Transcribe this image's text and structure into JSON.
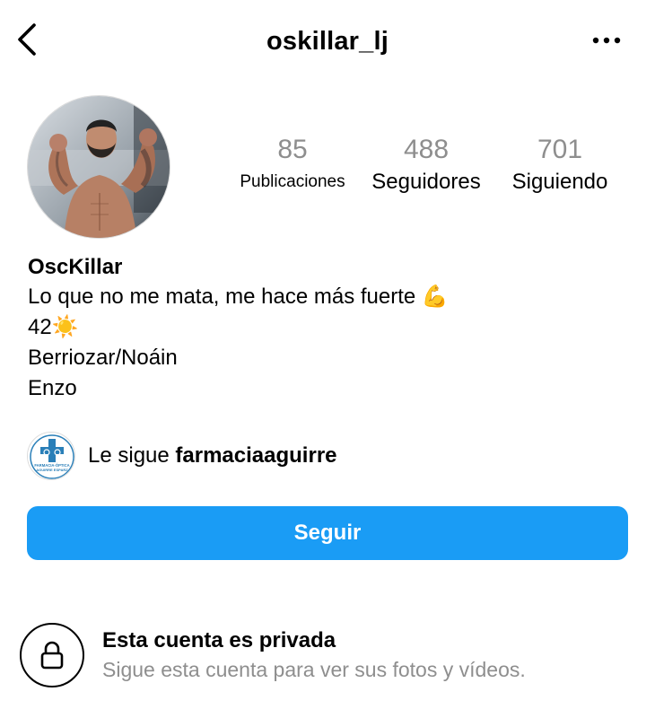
{
  "header": {
    "username": "oskillar_lj",
    "back_icon": "chevron-left-icon",
    "more_icon": "more-horizontal-icon"
  },
  "stats": {
    "posts": {
      "value": "85",
      "label": "Publicaciones"
    },
    "followers": {
      "value": "488",
      "label": "Seguidores"
    },
    "following": {
      "value": "701",
      "label": "Siguiendo"
    }
  },
  "bio": {
    "name": "OscKillar",
    "line1": "Lo que no me mata, me hace más fuerte 💪",
    "line2": "42☀️",
    "line3": "Berriozar/Noáin",
    "line4": "Enzo"
  },
  "followed_by": {
    "prefix": "Le sigue ",
    "account": "farmaciaaguirre",
    "logo_text_1": "FARMACIA-ÓPTICA",
    "logo_text_2": "AGUIRRE ESPARZ"
  },
  "follow_button": {
    "label": "Seguir"
  },
  "private_notice": {
    "title": "Esta cuenta es privada",
    "subtitle": "Sigue esta cuenta para ver sus fotos y vídeos.",
    "icon": "lock-icon"
  },
  "colors": {
    "accent": "#1a9cf5",
    "muted": "#8e8e8e",
    "logo_blue": "#2a7fb8"
  }
}
